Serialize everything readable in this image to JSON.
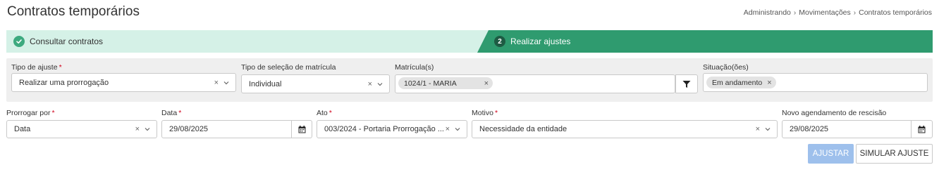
{
  "page": {
    "title": "Contratos temporários"
  },
  "breadcrumb": [
    "Administrando",
    "Movimentações",
    "Contratos temporários"
  ],
  "stepper": {
    "step1_label": "Consultar contratos",
    "step2_number": "2",
    "step2_label": "Realizar ajustes"
  },
  "filters": {
    "tipo_ajuste": {
      "label": "Tipo de ajuste",
      "value": "Realizar uma prorrogação"
    },
    "tipo_selecao": {
      "label": "Tipo de seleção de matrícula",
      "value": "Individual"
    },
    "matriculas": {
      "label": "Matrícula(s)",
      "tag": "1024/1 - MARIA"
    },
    "situacoes": {
      "label": "Situação(ões)",
      "tag": "Em andamento"
    }
  },
  "form": {
    "prorrogar_por": {
      "label": "Prorrogar por",
      "value": "Data"
    },
    "data": {
      "label": "Data",
      "value": "29/08/2025"
    },
    "ato": {
      "label": "Ato",
      "value": "003/2024 - Portaria Prorrogação ..."
    },
    "motivo": {
      "label": "Motivo",
      "value": "Necessidade da entidade"
    },
    "novo_agendamento": {
      "label": "Novo agendamento de rescisão",
      "value": "29/08/2025"
    }
  },
  "actions": {
    "ajustar": "AJUSTAR",
    "simular": "SIMULAR AJUSTE"
  },
  "symbols": {
    "sep": "›",
    "clear": "×",
    "required": "*"
  },
  "colors": {
    "step1_bg": "#d5f1e7",
    "step2_bg": "#2f9b6f",
    "primary_disabled": "#9ec0ec",
    "required": "#d0021b"
  }
}
